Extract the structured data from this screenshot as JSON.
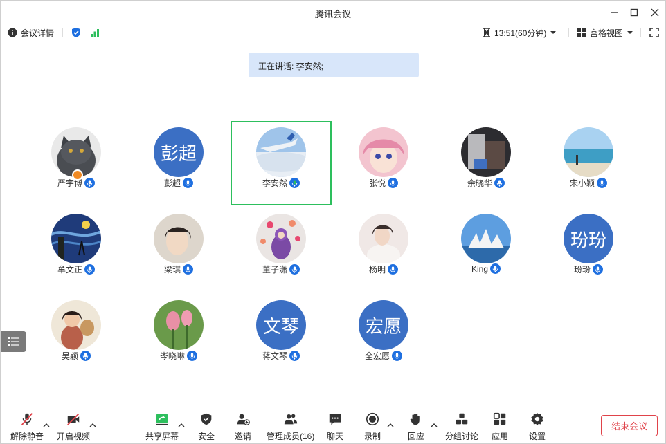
{
  "window": {
    "title": "腾讯会议"
  },
  "infobar": {
    "details_label": "会议详情",
    "timer_label": "13:51(60分钟)",
    "view_label": "宫格视图"
  },
  "speaking": {
    "text": "正在讲话: 李安然;"
  },
  "participants": [
    {
      "name": "严宇博",
      "avatar_type": "photo-cat"
    },
    {
      "name": "彭超",
      "avatar_type": "text",
      "avatar_text": "彭超"
    },
    {
      "name": "李安然",
      "avatar_type": "photo-sky",
      "speaking": true
    },
    {
      "name": "张悦",
      "avatar_type": "photo-anime"
    },
    {
      "name": "余晓华",
      "avatar_type": "photo-dark"
    },
    {
      "name": "宋小颖",
      "avatar_type": "photo-beach"
    },
    {
      "name": "牟文正",
      "avatar_type": "photo-starry"
    },
    {
      "name": "梁琪",
      "avatar_type": "photo-child"
    },
    {
      "name": "董子潇",
      "avatar_type": "photo-teletubby"
    },
    {
      "name": "杨明",
      "avatar_type": "photo-woman"
    },
    {
      "name": "King",
      "avatar_type": "photo-opera"
    },
    {
      "name": "玢玢",
      "avatar_type": "text",
      "avatar_text": "玢玢"
    },
    {
      "name": "吴颖",
      "avatar_type": "photo-girl"
    },
    {
      "name": "岑晓琳",
      "avatar_type": "photo-lotus"
    },
    {
      "name": "蒋文琴",
      "avatar_type": "text",
      "avatar_text": "文琴"
    },
    {
      "name": "全宏愿",
      "avatar_type": "text",
      "avatar_text": "宏愿"
    }
  ],
  "toolbar": {
    "unmute": "解除静音",
    "start_video": "开启视频",
    "share_screen": "共享屏幕",
    "security": "安全",
    "invite": "邀请",
    "manage_members": "管理成员(16)",
    "chat": "聊天",
    "record": "录制",
    "react": "回应",
    "breakout": "分组讨论",
    "apps": "应用",
    "settings": "设置",
    "end_meeting": "结束会议"
  },
  "colors": {
    "accent_blue": "#1e6fe0",
    "avatar_blue": "#3b6fc4",
    "speaking_border": "#2dbf5d",
    "end_red": "#e0434a",
    "banner_bg": "#d8e6fa"
  }
}
